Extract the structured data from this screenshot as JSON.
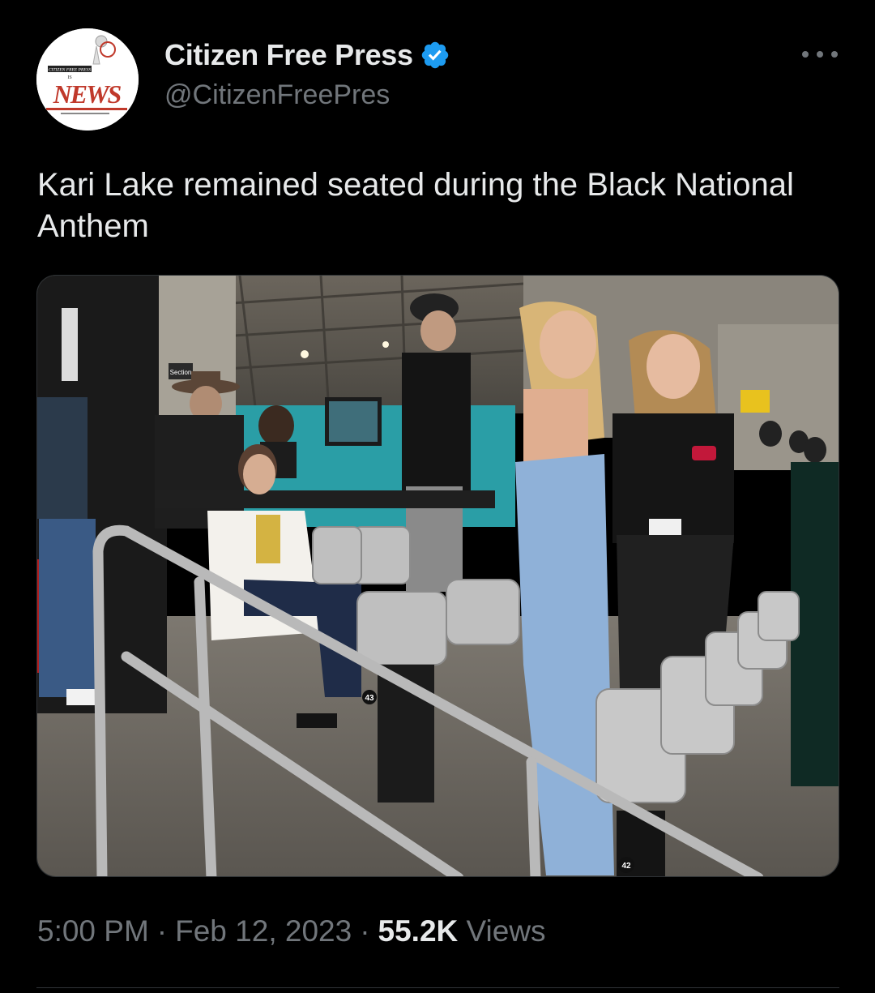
{
  "tweet": {
    "author": {
      "display_name": "Citizen Free Press",
      "handle": "@CitizenFreePres",
      "verified": true,
      "avatar_logo_text": "NEWS",
      "avatar_small_text_top": "CITIZEN FREE PRESS",
      "avatar_small_text_mid": "IS"
    },
    "text": "Kari Lake remained seated during the Black National Anthem",
    "media": {
      "seat_numbers": [
        "43",
        "42"
      ],
      "section_sign": "Section"
    },
    "timestamp": {
      "time": "5:00 PM",
      "separator": "·",
      "date": "Feb 12, 2023",
      "views_count": "55.2K",
      "views_label": "Views"
    }
  },
  "colors": {
    "background": "#000000",
    "primary_text": "#e7e9ea",
    "secondary_text": "#71767b",
    "verified_badge": "#1d9bf0",
    "divider": "#2f3336"
  },
  "icons": {
    "verified": "verified-badge-icon",
    "more": "more-options-icon"
  }
}
